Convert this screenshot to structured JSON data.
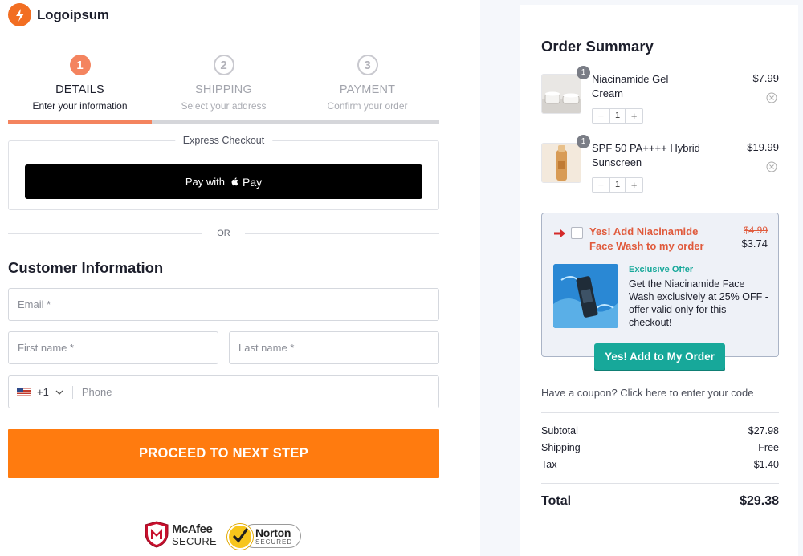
{
  "brand": {
    "name": "Logoipsum",
    "accent": "#f26e22"
  },
  "steps": [
    {
      "number": "1",
      "title": "DETAILS",
      "subtitle": "Enter your information",
      "active": true
    },
    {
      "number": "2",
      "title": "SHIPPING",
      "subtitle": "Select your address",
      "active": false
    },
    {
      "number": "3",
      "title": "PAYMENT",
      "subtitle": "Confirm your order",
      "active": false
    }
  ],
  "progress": {
    "completed_fraction": 0.333
  },
  "express": {
    "label": "Express Checkout",
    "button_prefix": "Pay with",
    "button_pay": "Pay"
  },
  "divider_text": "OR",
  "customer": {
    "title": "Customer Information",
    "email_placeholder": "Email *",
    "first_name_placeholder": "First name *",
    "last_name_placeholder": "Last name *",
    "dial_code": "+1",
    "phone_placeholder": "Phone"
  },
  "proceed_label": "PROCEED TO NEXT STEP",
  "badges": {
    "mcafee_name": "McAfee",
    "mcafee_sub": "SECURE",
    "norton_name": "Norton",
    "norton_sub": "SECURED"
  },
  "summary": {
    "title": "Order Summary",
    "items": [
      {
        "name": "Niacinamide Gel Cream",
        "price": "$7.99",
        "qty": "1",
        "badge": "1",
        "minus": "−",
        "plus": "+"
      },
      {
        "name": "SPF 50 PA++++ Hybrid Sunscreen",
        "price": "$19.99",
        "qty": "1",
        "badge": "1",
        "minus": "−",
        "plus": "+"
      }
    ],
    "upsell": {
      "title": "Yes! Add Niacinamide Face Wash to my order",
      "old_price": "$4.99",
      "new_price": "$3.74",
      "tag": "Exclusive Offer",
      "description": "Get the Niacinamide Face Wash exclusively at 25% OFF - offer valid only for this checkout!",
      "button": "Yes! Add to My Order"
    },
    "coupon_text": "Have a coupon? Click here to enter your code",
    "subtotal_label": "Subtotal",
    "subtotal_value": "$27.98",
    "shipping_label": "Shipping",
    "shipping_value": "Free",
    "tax_label": "Tax",
    "tax_value": "$1.40",
    "total_label": "Total",
    "total_value": "$29.38"
  }
}
